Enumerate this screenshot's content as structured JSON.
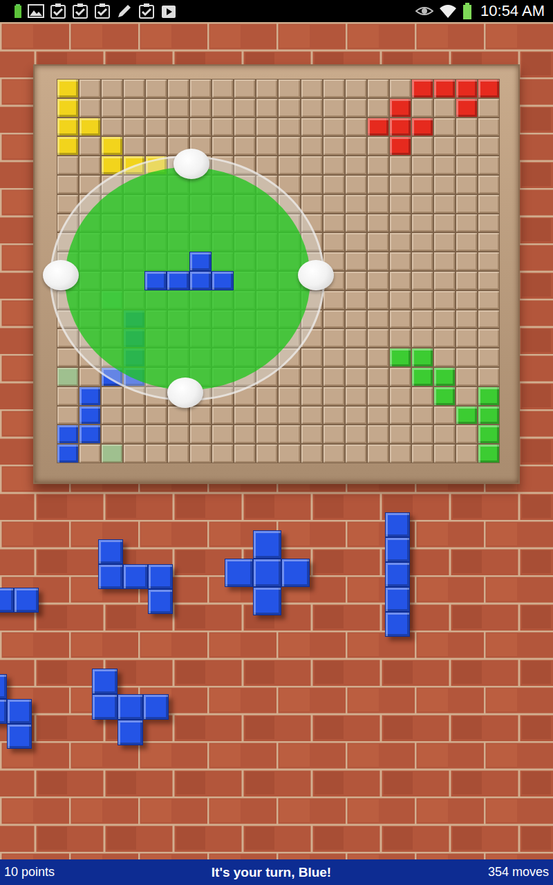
{
  "status_bar": {
    "time": "10:54 AM"
  },
  "board": {
    "size": 20,
    "pieces": [
      {
        "color": "#f2d41c",
        "cells": [
          [
            0,
            0
          ],
          [
            1,
            0
          ],
          [
            2,
            0
          ],
          [
            3,
            0
          ],
          [
            2,
            1
          ]
        ]
      },
      {
        "color": "#f2d41c",
        "cells": [
          [
            3,
            2
          ],
          [
            4,
            2
          ],
          [
            4,
            3
          ],
          [
            4,
            4
          ]
        ]
      },
      {
        "color": "#e62a1e",
        "cells": [
          [
            0,
            16
          ],
          [
            0,
            17
          ],
          [
            0,
            18
          ],
          [
            0,
            19
          ],
          [
            1,
            18
          ]
        ]
      },
      {
        "color": "#e62a1e",
        "cells": [
          [
            1,
            15
          ],
          [
            2,
            14
          ],
          [
            2,
            15
          ],
          [
            2,
            16
          ],
          [
            3,
            15
          ]
        ]
      },
      {
        "color": "#3ccc32",
        "cells": [
          [
            14,
            15
          ],
          [
            14,
            16
          ],
          [
            15,
            16
          ],
          [
            15,
            17
          ],
          [
            16,
            17
          ]
        ]
      },
      {
        "color": "#3ccc32",
        "cells": [
          [
            17,
            18
          ],
          [
            16,
            19
          ],
          [
            17,
            19
          ],
          [
            18,
            19
          ],
          [
            19,
            19
          ]
        ]
      },
      {
        "color": "#2454e6",
        "cells": [
          [
            19,
            0
          ],
          [
            18,
            0
          ],
          [
            18,
            1
          ],
          [
            17,
            1
          ],
          [
            16,
            1
          ]
        ]
      },
      {
        "color": "#2454e6",
        "cells": [
          [
            12,
            3
          ],
          [
            13,
            3
          ],
          [
            14,
            3
          ],
          [
            15,
            3
          ],
          [
            15,
            2
          ]
        ]
      }
    ],
    "hints": [
      [
        15,
        0
      ],
      [
        19,
        2
      ],
      [
        11,
        2
      ]
    ]
  },
  "selector": {
    "color": "#2454e6",
    "cells": [
      [
        9,
        6
      ],
      [
        10,
        4
      ],
      [
        10,
        5
      ],
      [
        10,
        6
      ],
      [
        10,
        7
      ]
    ]
  },
  "tray": {
    "color": "#2454e6",
    "pieces": [
      {
        "cells": [
          [
            0,
            0
          ],
          [
            0,
            1
          ]
        ]
      },
      {
        "cells": [
          [
            0,
            0
          ],
          [
            1,
            0
          ],
          [
            1,
            1
          ],
          [
            1,
            2
          ],
          [
            2,
            2
          ]
        ]
      },
      {
        "cells": [
          [
            0,
            1
          ],
          [
            1,
            0
          ],
          [
            1,
            1
          ],
          [
            1,
            2
          ],
          [
            2,
            1
          ]
        ]
      },
      {
        "cells": [
          [
            0,
            0
          ],
          [
            1,
            0
          ],
          [
            2,
            0
          ],
          [
            3,
            0
          ],
          [
            4,
            0
          ]
        ]
      },
      {
        "cells": [
          [
            0,
            0
          ],
          [
            1,
            0
          ],
          [
            1,
            1
          ],
          [
            2,
            1
          ]
        ]
      },
      {
        "cells": [
          [
            0,
            0
          ],
          [
            1,
            0
          ],
          [
            1,
            1
          ],
          [
            1,
            2
          ],
          [
            2,
            1
          ]
        ]
      }
    ]
  },
  "footer": {
    "points": "10 points",
    "message": "It's your turn, Blue!",
    "moves": "354 moves"
  }
}
